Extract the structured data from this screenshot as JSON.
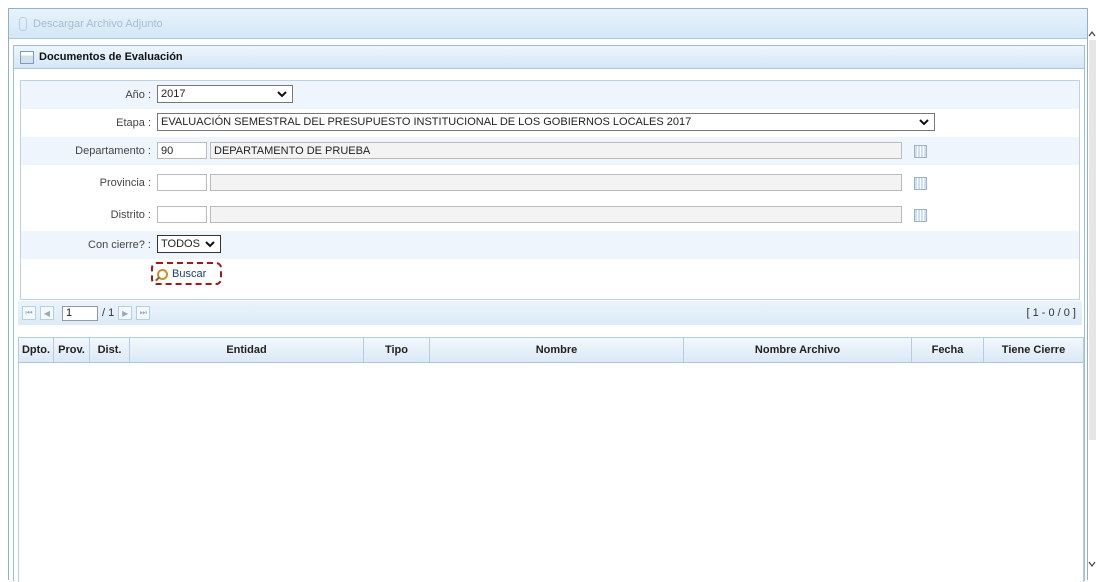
{
  "toolbar": {
    "download_label": "Descargar Archivo Adjunto"
  },
  "panel": {
    "title": "Documentos de Evaluación"
  },
  "form": {
    "anio": {
      "label": "Año :",
      "value": "2017"
    },
    "etapa": {
      "label": "Etapa :",
      "value": "EVALUACIÓN SEMESTRAL DEL PRESUPUESTO INSTITUCIONAL DE LOS GOBIERNOS LOCALES 2017"
    },
    "departamento": {
      "label": "Departamento :",
      "code": "90",
      "name": "DEPARTAMENTO DE PRUEBA"
    },
    "provincia": {
      "label": "Provincia :",
      "code": "",
      "name": ""
    },
    "distrito": {
      "label": "Distrito :",
      "code": "",
      "name": ""
    },
    "cierre": {
      "label": "Con cierre? :",
      "value": "TODOS"
    },
    "buscar_label": "Buscar"
  },
  "pager": {
    "page": "1",
    "of": "/ 1",
    "count": "[ 1 - 0 / 0 ]"
  },
  "grid": {
    "columns": [
      "Dpto.",
      "Prov.",
      "Dist.",
      "Entidad",
      "Tipo",
      "Nombre",
      "Nombre Archivo",
      "Fecha",
      "Tiene Cierre"
    ]
  }
}
